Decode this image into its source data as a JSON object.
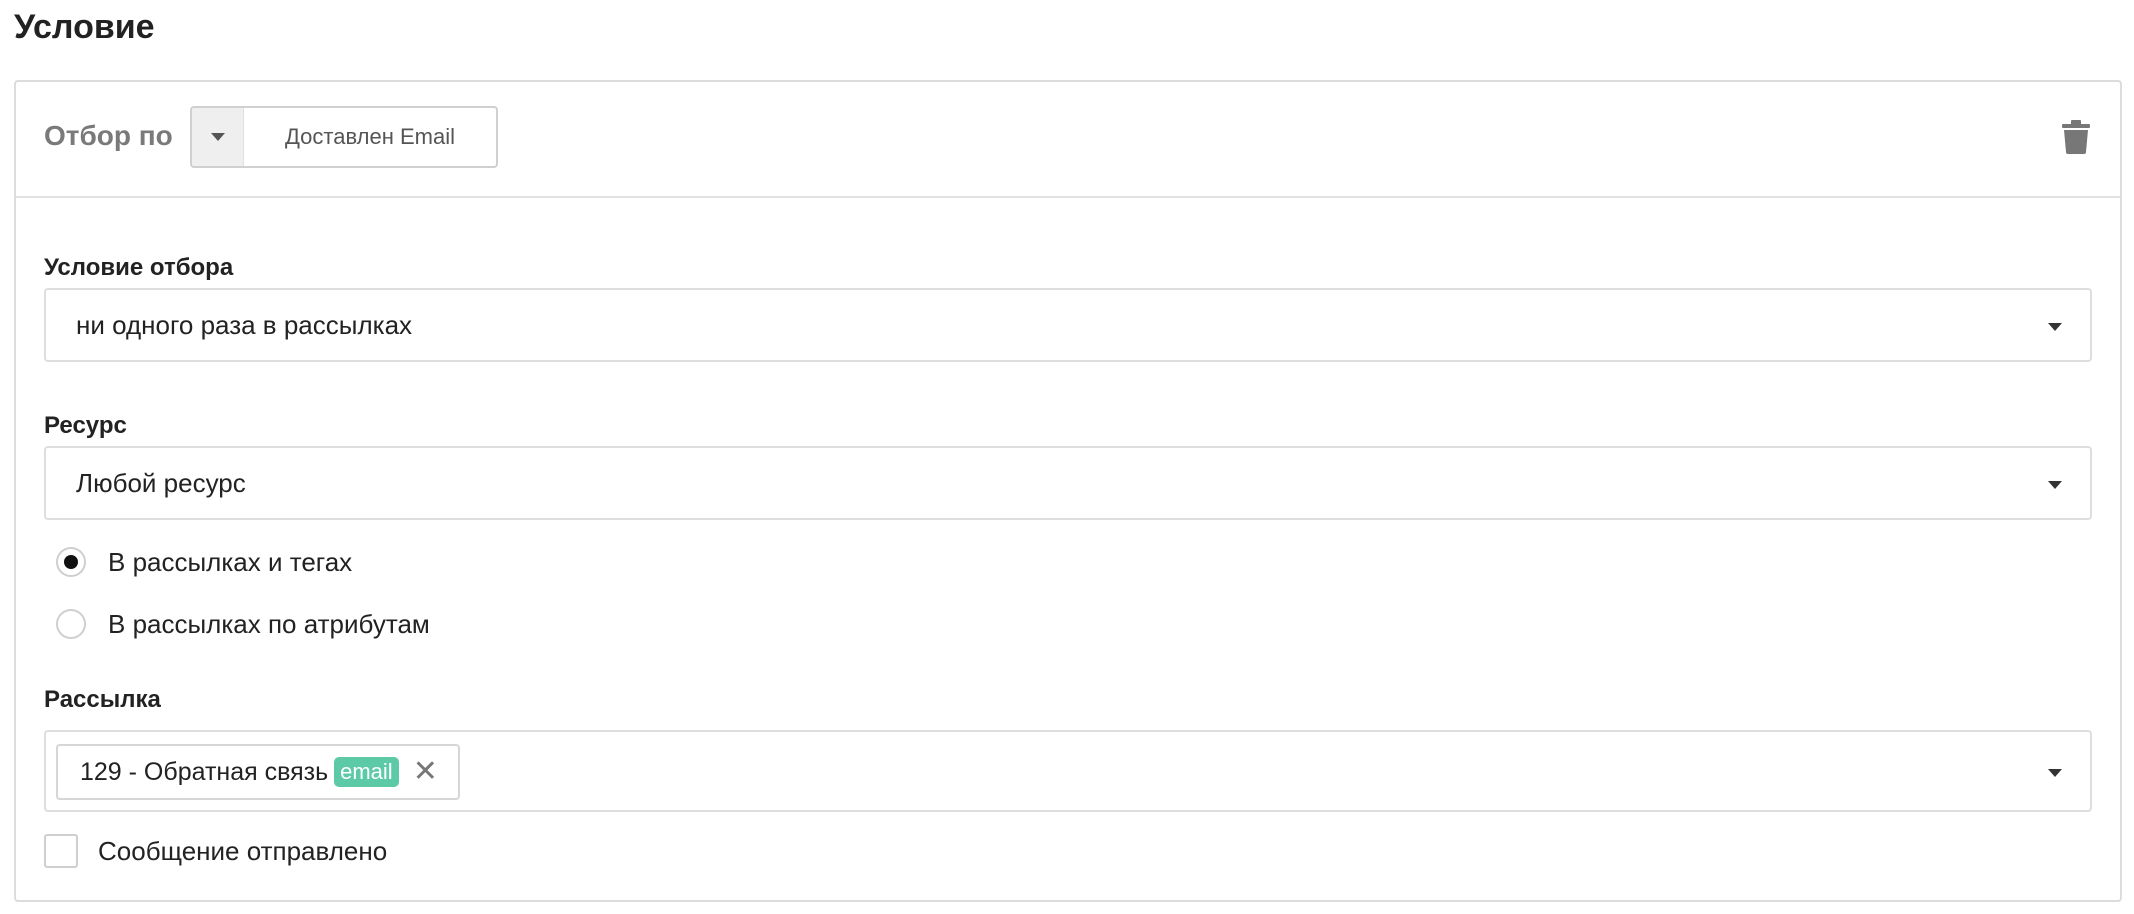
{
  "section": {
    "title": "Условие"
  },
  "filter": {
    "label": "Отбор по",
    "selected": "Доставлен Email",
    "delete_icon": "trash-icon"
  },
  "condition": {
    "label": "Условие отбора",
    "selected": "ни одного раза в рассылках"
  },
  "resource": {
    "label": "Ресурс",
    "selected": "Любой ресурс"
  },
  "mode_options": [
    {
      "label": "В рассылках и тегах",
      "checked": true
    },
    {
      "label": "В рассылках по атрибутам",
      "checked": false
    }
  ],
  "mailing": {
    "label": "Рассылка",
    "chips": [
      {
        "text": "129 - Обратная связь",
        "badge": "email",
        "remove": "✕"
      }
    ]
  },
  "message_sent": {
    "label": "Сообщение отправлено",
    "checked": false
  },
  "colors": {
    "badge": "#5cc9a7",
    "border": "#dedede",
    "muted_label": "#7a7a7a"
  }
}
